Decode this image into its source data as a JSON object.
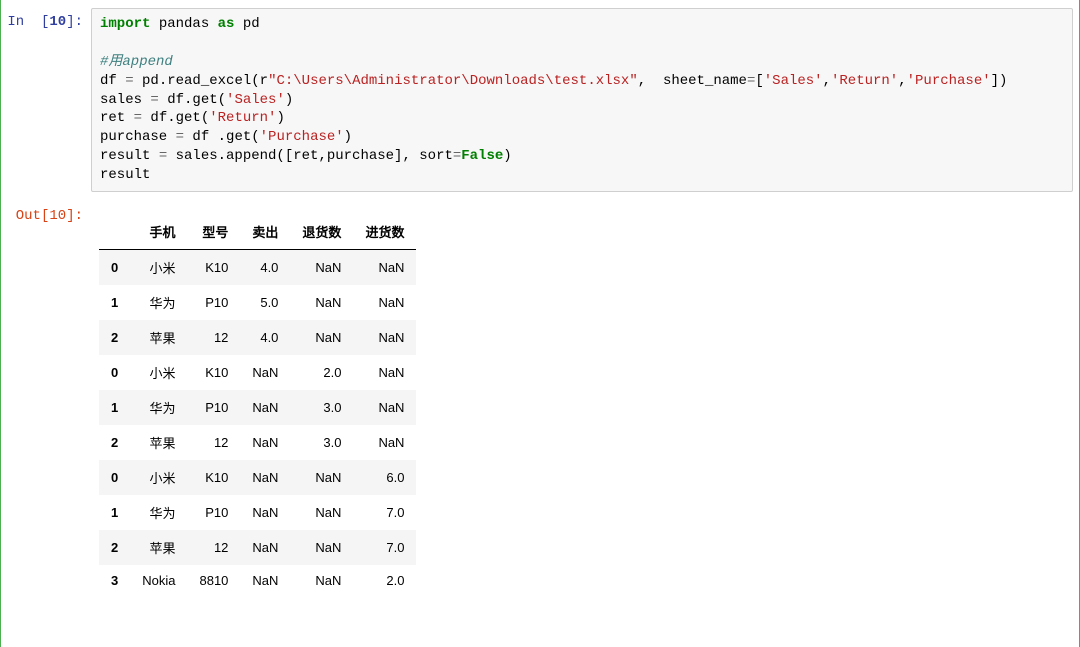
{
  "input": {
    "prompt_label": "In ",
    "prompt_open": "[",
    "prompt_num": "10",
    "prompt_close": "]:",
    "code": {
      "l1_import": "import",
      "l1_pandas": " pandas ",
      "l1_as": "as",
      "l1_pd": " pd",
      "l3_comment": "#用append",
      "l4_a": "df ",
      "l4_eq": "=",
      "l4_b": " pd.read_excel(",
      "l4_r": "r",
      "l4_path": "\"C:\\Users\\Administrator\\Downloads\\test.xlsx\"",
      "l4_c": ",  sheet_name",
      "l4_eq2": "=",
      "l4_d": "[",
      "l4_s1": "'Sales'",
      "l4_comma1": ",",
      "l4_s2": "'Return'",
      "l4_comma2": ",",
      "l4_s3": "'Purchase'",
      "l4_e": "])",
      "l5_a": "sales ",
      "l5_eq": "=",
      "l5_b": " df.get(",
      "l5_s": "'Sales'",
      "l5_c": ")",
      "l6_a": "ret ",
      "l6_eq": "=",
      "l6_b": " df.get(",
      "l6_s": "'Return'",
      "l6_c": ")",
      "l7_a": "purchase ",
      "l7_eq": "=",
      "l7_b": " df .get(",
      "l7_s": "'Purchase'",
      "l7_c": ")",
      "l8_a": "result ",
      "l8_eq": "=",
      "l8_b": " sales.append([ret,purchase], sort",
      "l8_eq2": "=",
      "l8_bool": "False",
      "l8_c": ")",
      "l9": "result"
    }
  },
  "output": {
    "prompt_label": "Out",
    "prompt_open": "[",
    "prompt_num": "10",
    "prompt_close": "]:",
    "headers": [
      "",
      "手机",
      "型号",
      "卖出",
      "退货数",
      "进货数"
    ],
    "rows": [
      [
        "0",
        "小米",
        "K10",
        "4.0",
        "NaN",
        "NaN"
      ],
      [
        "1",
        "华为",
        "P10",
        "5.0",
        "NaN",
        "NaN"
      ],
      [
        "2",
        "苹果",
        "12",
        "4.0",
        "NaN",
        "NaN"
      ],
      [
        "0",
        "小米",
        "K10",
        "NaN",
        "2.0",
        "NaN"
      ],
      [
        "1",
        "华为",
        "P10",
        "NaN",
        "3.0",
        "NaN"
      ],
      [
        "2",
        "苹果",
        "12",
        "NaN",
        "3.0",
        "NaN"
      ],
      [
        "0",
        "小米",
        "K10",
        "NaN",
        "NaN",
        "6.0"
      ],
      [
        "1",
        "华为",
        "P10",
        "NaN",
        "NaN",
        "7.0"
      ],
      [
        "2",
        "苹果",
        "12",
        "NaN",
        "NaN",
        "7.0"
      ],
      [
        "3",
        "Nokia",
        "8810",
        "NaN",
        "NaN",
        "2.0"
      ]
    ]
  }
}
